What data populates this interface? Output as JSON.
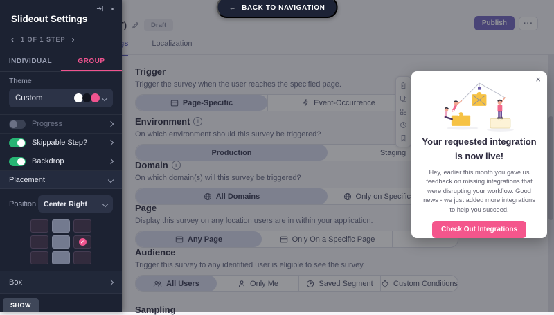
{
  "colors": {
    "accent_pink": "#f0548f",
    "toggle_green": "#27b574",
    "publish_purple": "#7a6fc5",
    "modal_cta_pink": "#f4568c",
    "sidebar_bg": "#1c2232"
  },
  "back_nav": {
    "label": "BACK TO NAVIGATION",
    "arrow": "←"
  },
  "header": {
    "title_suffix": "(AT)",
    "draft_badge": "Draft",
    "tabs": {
      "settings": "Settings",
      "localization": "Localization"
    },
    "publish_label": "Publish",
    "more_label": "···"
  },
  "sidebar": {
    "title": "Slideout Settings",
    "step_prev": "‹",
    "step_label": "1 OF 1 STEP",
    "step_next": "›",
    "tabs": {
      "individual": "INDIVIDUAL",
      "group": "GROUP"
    },
    "theme": {
      "label": "Theme",
      "value": "Custom"
    },
    "rows": {
      "progress": {
        "label": "Progress",
        "state": "off"
      },
      "skippable": {
        "label": "Skippable Step?",
        "state": "on"
      },
      "backdrop": {
        "label": "Backdrop",
        "state": "on"
      }
    },
    "placement_label": "Placement",
    "position": {
      "label": "Position",
      "value": "Center Right",
      "selected_cell": "center-right",
      "check": "✓"
    },
    "box_label": "Box",
    "show_label": "SHOW"
  },
  "content": {
    "sections": [
      {
        "title": "Trigger",
        "desc": "Trigger the survey when the user reaches the specified page.",
        "options": [
          {
            "label": "Page-Specific",
            "selected": true,
            "icon": "window-icon"
          },
          {
            "label": "Event-Occurrence",
            "selected": false,
            "icon": "lightning-icon"
          },
          {
            "label": "",
            "selected": false
          }
        ]
      },
      {
        "title": "Environment",
        "info": true,
        "desc": "On which environment should this survey be triggered?",
        "options": [
          {
            "label": "Production",
            "selected": true
          },
          {
            "label": "Staging",
            "selected": false
          }
        ]
      },
      {
        "title": "Domain",
        "info": true,
        "desc": "On which domain(s) will this survey be triggered?",
        "options": [
          {
            "label": "All Domains",
            "selected": true,
            "icon": "globe-icon"
          },
          {
            "label": "Only on Specific Domains",
            "selected": false,
            "icon": "globe-icon"
          }
        ]
      },
      {
        "title": "Page",
        "desc": "Display this survey on any location users are in within your application.",
        "options": [
          {
            "label": "Any Page",
            "selected": true,
            "icon": "window-icon"
          },
          {
            "label": "Only On a Specific Page",
            "selected": false,
            "icon": "window-icon"
          },
          {
            "label": "",
            "selected": false
          }
        ]
      },
      {
        "title": "Audience",
        "desc": "Trigger this survey to any identified user is eligible to see the survey.",
        "options": [
          {
            "label": "All Users",
            "selected": true,
            "icon": "users-icon"
          },
          {
            "label": "Only Me",
            "selected": false,
            "icon": "user-icon"
          },
          {
            "label": "Saved Segment",
            "selected": false,
            "icon": "pie-icon"
          },
          {
            "label": "Custom Conditions",
            "selected": false,
            "icon": "diamond-icon"
          }
        ]
      },
      {
        "title": "Sampling",
        "desc": "",
        "options": []
      }
    ]
  },
  "toolbar_icons": [
    "trash-icon",
    "copy-icon",
    "widgets-icon",
    "history-icon",
    "bookmark-icon"
  ],
  "modal": {
    "close": "×",
    "title": "Your requested integration is now live!",
    "body": "Hey, earlier this month you gave us feedback on missing integrations that were disrupting your workflow. Good news - we just added more integrations to help you succeed.",
    "cta": "Check Out Integrations"
  }
}
